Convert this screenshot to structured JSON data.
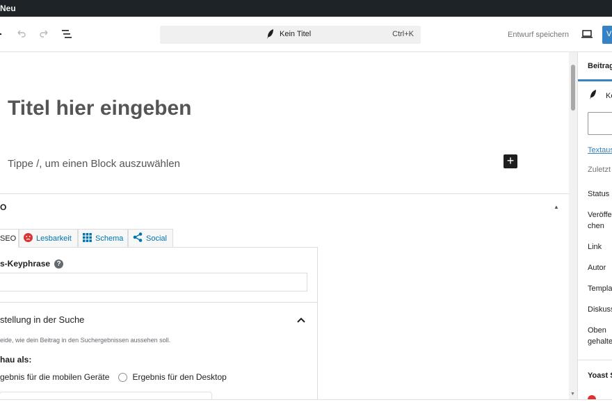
{
  "admin_bar": {
    "new_label": "Neu"
  },
  "header": {
    "command_title": "Kein Titel",
    "command_shortcut": "Ctrl+K",
    "save_draft_label": "Entwurf speichern",
    "publish_label": "V"
  },
  "editor": {
    "title_placeholder": "Titel hier eingeben",
    "block_placeholder": "Tippe /, um einen Block auszuwählen",
    "add_block_label": "+"
  },
  "yoast": {
    "title": "O",
    "tabs": [
      {
        "label": "SEO",
        "icon": "seo-icon"
      },
      {
        "label": "Lesbarkeit",
        "icon": "sad-face-icon",
        "color": "#dc3232"
      },
      {
        "label": "Schema",
        "icon": "grid-icon",
        "color": "#0073aa"
      },
      {
        "label": "Social",
        "icon": "share-icon",
        "color": "#0073aa"
      }
    ],
    "keyphrase_label": "s-Keyphrase",
    "keyphrase_help": "?",
    "keyphrase_value": "",
    "search_heading": "stellung in der Suche",
    "search_description": "eide, wie dein Beitrag in den Suchergebnissen aussehen soll.",
    "preview_label": "hau als:",
    "preview_options": [
      "gebnis für die mobilen Geräte",
      "Ergebnis für den Desktop"
    ]
  },
  "sidebar": {
    "tab_label": "Beitrag",
    "post_title": "Ke",
    "items": {
      "textauszug": "Textaus",
      "zuletzt": "Zuletzt",
      "status": "Status",
      "veroeffentlichen_1": "Veröffer",
      "veroeffentlichen_2": "chen",
      "link": "Link",
      "autor": "Autor",
      "template": "Templat",
      "diskussion": "Diskuss",
      "oben_1": "Oben",
      "oben_2": "gehalte",
      "yoast": "Yoast S"
    }
  },
  "colors": {
    "accent": "#3582c4",
    "error": "#dc3232",
    "admin_bar": "#1d2327"
  }
}
